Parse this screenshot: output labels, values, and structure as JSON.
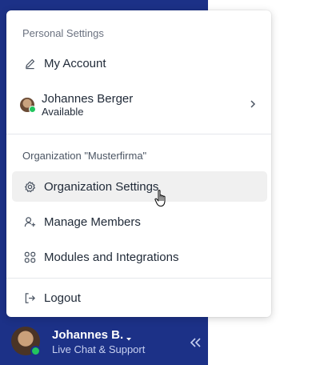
{
  "menu": {
    "personal_section_label": "Personal Settings",
    "my_account_label": "My Account",
    "user": {
      "name": "Johannes Berger",
      "status": "Available"
    },
    "org_section_label": "Organization \"Musterfirma\"",
    "org_settings_label": "Organization Settings",
    "manage_members_label": "Manage Members",
    "modules_label": "Modules and Integrations",
    "logout_label": "Logout"
  },
  "bottom_bar": {
    "name": "Johannes B.",
    "subtitle": "Live Chat & Support"
  },
  "colors": {
    "sidebar": "#1c3187",
    "menu_bg": "#ffffff",
    "active_item_bg": "#f0f0f0",
    "online_status": "#22c55e"
  },
  "icons": {
    "my_account": "pencil-icon",
    "org_settings": "gear-icon",
    "manage_members": "user-plus-icon",
    "modules": "grid-icon",
    "logout": "logout-icon",
    "user_row": "chevron-right-icon",
    "bottom_name": "caret-down-icon",
    "collapse": "double-chevron-left-icon"
  }
}
